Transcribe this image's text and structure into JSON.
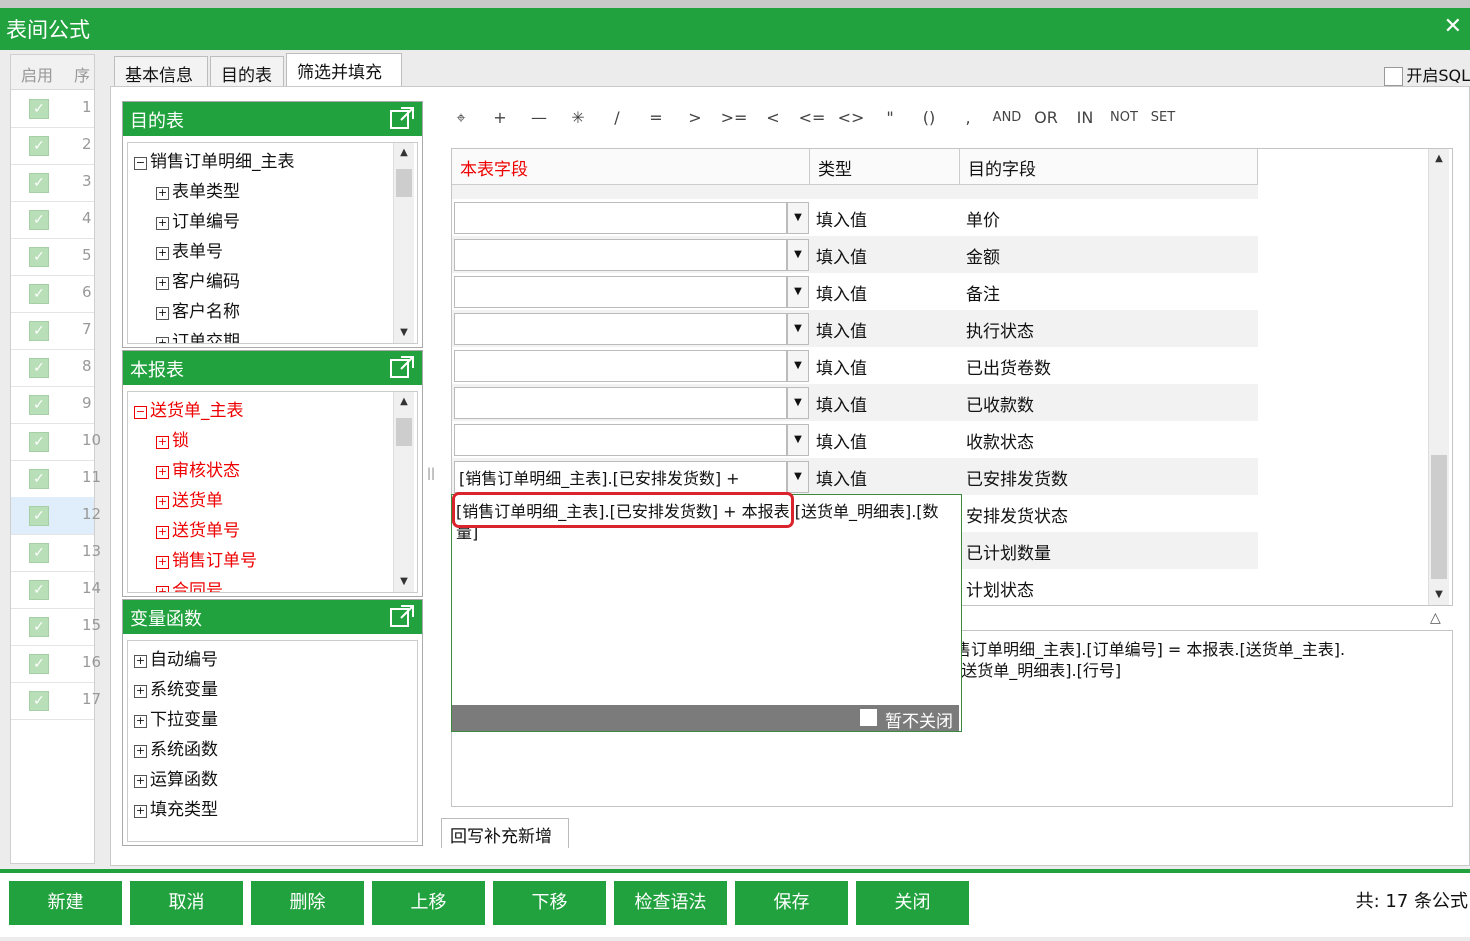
{
  "window": {
    "title": "表间公式",
    "close_glyph": "✕"
  },
  "left_grid": {
    "headers": [
      "启用",
      "序"
    ],
    "rows": [
      "1",
      "2",
      "3",
      "4",
      "5",
      "6",
      "7",
      "8",
      "9",
      "10",
      "11",
      "12",
      "13",
      "14",
      "15",
      "16",
      "17"
    ],
    "selected_index": 11
  },
  "tabs": [
    "基本信息",
    "目的表",
    "筛选并填充"
  ],
  "active_tab": 2,
  "sql_label": "开启SQL",
  "panels": {
    "dest": {
      "title": "目的表",
      "items": [
        {
          "label": "销售订单明细_主表",
          "sign": "−",
          "level": 0
        },
        {
          "label": "表单类型",
          "sign": "+",
          "level": 1
        },
        {
          "label": "订单编号",
          "sign": "+",
          "level": 1
        },
        {
          "label": "表单号",
          "sign": "+",
          "level": 1
        },
        {
          "label": "客户编码",
          "sign": "+",
          "level": 1
        },
        {
          "label": "客户名称",
          "sign": "+",
          "level": 1
        },
        {
          "label": "订单交期",
          "sign": "+",
          "level": 1
        }
      ]
    },
    "report": {
      "title": "本报表",
      "items": [
        {
          "label": "送货单_主表",
          "sign": "−",
          "level": 0
        },
        {
          "label": "锁",
          "sign": "+",
          "level": 1
        },
        {
          "label": "审核状态",
          "sign": "+",
          "level": 1
        },
        {
          "label": "送货单",
          "sign": "+",
          "level": 1
        },
        {
          "label": "送货单号",
          "sign": "+",
          "level": 1
        },
        {
          "label": "销售订单号",
          "sign": "+",
          "level": 1
        },
        {
          "label": "合同号",
          "sign": "+",
          "level": 1
        }
      ]
    },
    "vars": {
      "title": "变量函数",
      "items": [
        {
          "label": "自动编号",
          "sign": "+",
          "level": 0
        },
        {
          "label": "系统变量",
          "sign": "+",
          "level": 0
        },
        {
          "label": "下拉变量",
          "sign": "+",
          "level": 0
        },
        {
          "label": "系统函数",
          "sign": "+",
          "level": 0
        },
        {
          "label": "运算函数",
          "sign": "+",
          "level": 0
        },
        {
          "label": "填充类型",
          "sign": "+",
          "level": 0
        }
      ]
    }
  },
  "toolbar": [
    {
      "label": "⌖",
      "name": "wand-icon"
    },
    {
      "label": "+",
      "name": "plus-op"
    },
    {
      "label": "—",
      "name": "minus-op"
    },
    {
      "label": "✳",
      "name": "multiply-op"
    },
    {
      "label": "/",
      "name": "divide-op"
    },
    {
      "label": "=",
      "name": "equals-op"
    },
    {
      "label": ">",
      "name": "gt-op"
    },
    {
      "label": ">=",
      "name": "gte-op"
    },
    {
      "label": "<",
      "name": "lt-op"
    },
    {
      "label": "<=",
      "name": "lte-op"
    },
    {
      "label": "<>",
      "name": "ne-op"
    },
    {
      "label": "\"",
      "name": "quote-op"
    },
    {
      "label": "()",
      "name": "paren-op"
    },
    {
      "label": ",",
      "name": "comma-op"
    },
    {
      "label": "AND",
      "name": "and-op"
    },
    {
      "label": "OR",
      "name": "or-op"
    },
    {
      "label": "IN",
      "name": "in-op"
    },
    {
      "label": "NOT",
      "name": "not-op"
    },
    {
      "label": "SET",
      "name": "set-op"
    }
  ],
  "grid": {
    "headers": [
      "本表字段",
      "类型",
      "目的字段"
    ],
    "rows": [
      {
        "value": "",
        "type": "填入值",
        "dest": "单价"
      },
      {
        "value": "",
        "type": "填入值",
        "dest": "金额"
      },
      {
        "value": "",
        "type": "填入值",
        "dest": "备注"
      },
      {
        "value": "",
        "type": "填入值",
        "dest": "执行状态"
      },
      {
        "value": "",
        "type": "填入值",
        "dest": "已出货卷数"
      },
      {
        "value": "",
        "type": "填入值",
        "dest": "已收款数"
      },
      {
        "value": "",
        "type": "填入值",
        "dest": "收款状态"
      },
      {
        "value": "[销售订单明细_主表].[已安排发货数] +",
        "type": "填入值",
        "dest": "已安排发货数"
      },
      {
        "value": "",
        "type": "",
        "dest": "安排发货状态"
      },
      {
        "value": "",
        "type": "",
        "dest": "已计划数量"
      },
      {
        "value": "",
        "type": "",
        "dest": "计划状态"
      }
    ]
  },
  "editor": {
    "text": "[销售订单明细_主表].[已安排发货数] + 本报表.[送货单_明细表].[数量]",
    "footer_label": "暂不关闭"
  },
  "expression": {
    "line1": "售订单明细_主表].[订单编号]  =  本报表.[送货单_主表].",
    "line2": "[送货单_明细表].[行号]"
  },
  "bottom_tab": "回写补充新增",
  "buttons": [
    "新建",
    "取消",
    "删除",
    "上移",
    "下移",
    "检查语法",
    "保存",
    "关闭"
  ],
  "total": "共:  17 条公式"
}
